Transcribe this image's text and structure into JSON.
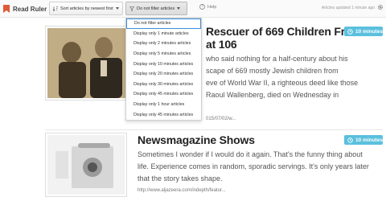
{
  "app": {
    "name": "Read Ruler"
  },
  "toolbar": {
    "sort_label": "Sort articles by newest first",
    "filter_label": "Do not filter articles",
    "help_label": "Help",
    "updated_text": "Articles updated 1 minute ago"
  },
  "filter_menu": {
    "items": [
      "Do not filter articles",
      "Display only 1 minute articles",
      "Display only 2 minutes articles",
      "Display only 5 minutes articles",
      "Display only 10 minutes articles",
      "Display only 20 minutes articles",
      "Display only 30 minutes articles",
      "Display only 45 minutes articles",
      "Display only 1 hour articles",
      "Display only 45 minutes articles"
    ]
  },
  "articles": [
    {
      "title_line1": "Rescuer of 669 Children From",
      "title_line2": "at 106",
      "reading_time": "10 minutes",
      "body_lines": [
        "who said nothing for a half-century about his",
        "scape of 669 mostly Jewish children from",
        "eve of World War II, a righteous deed like those",
        "Raoul Wallenberg, died on Wednesday in"
      ],
      "url": "015/07/02/w..."
    },
    {
      "title": "Newsmagazine Shows",
      "reading_time": "10 minutes",
      "body_lines": [
        "Sometimes I wonder if I would do it again. That's the funny thing about",
        "life. Experience comes in random, sporadic servings. It's only years later",
        "that the story takes shape."
      ],
      "url": "http://www.aljazeera.com/indepth/featur..."
    }
  ],
  "colors": {
    "badge": "#5bc0de",
    "menu_focus": "#3c8dde"
  }
}
